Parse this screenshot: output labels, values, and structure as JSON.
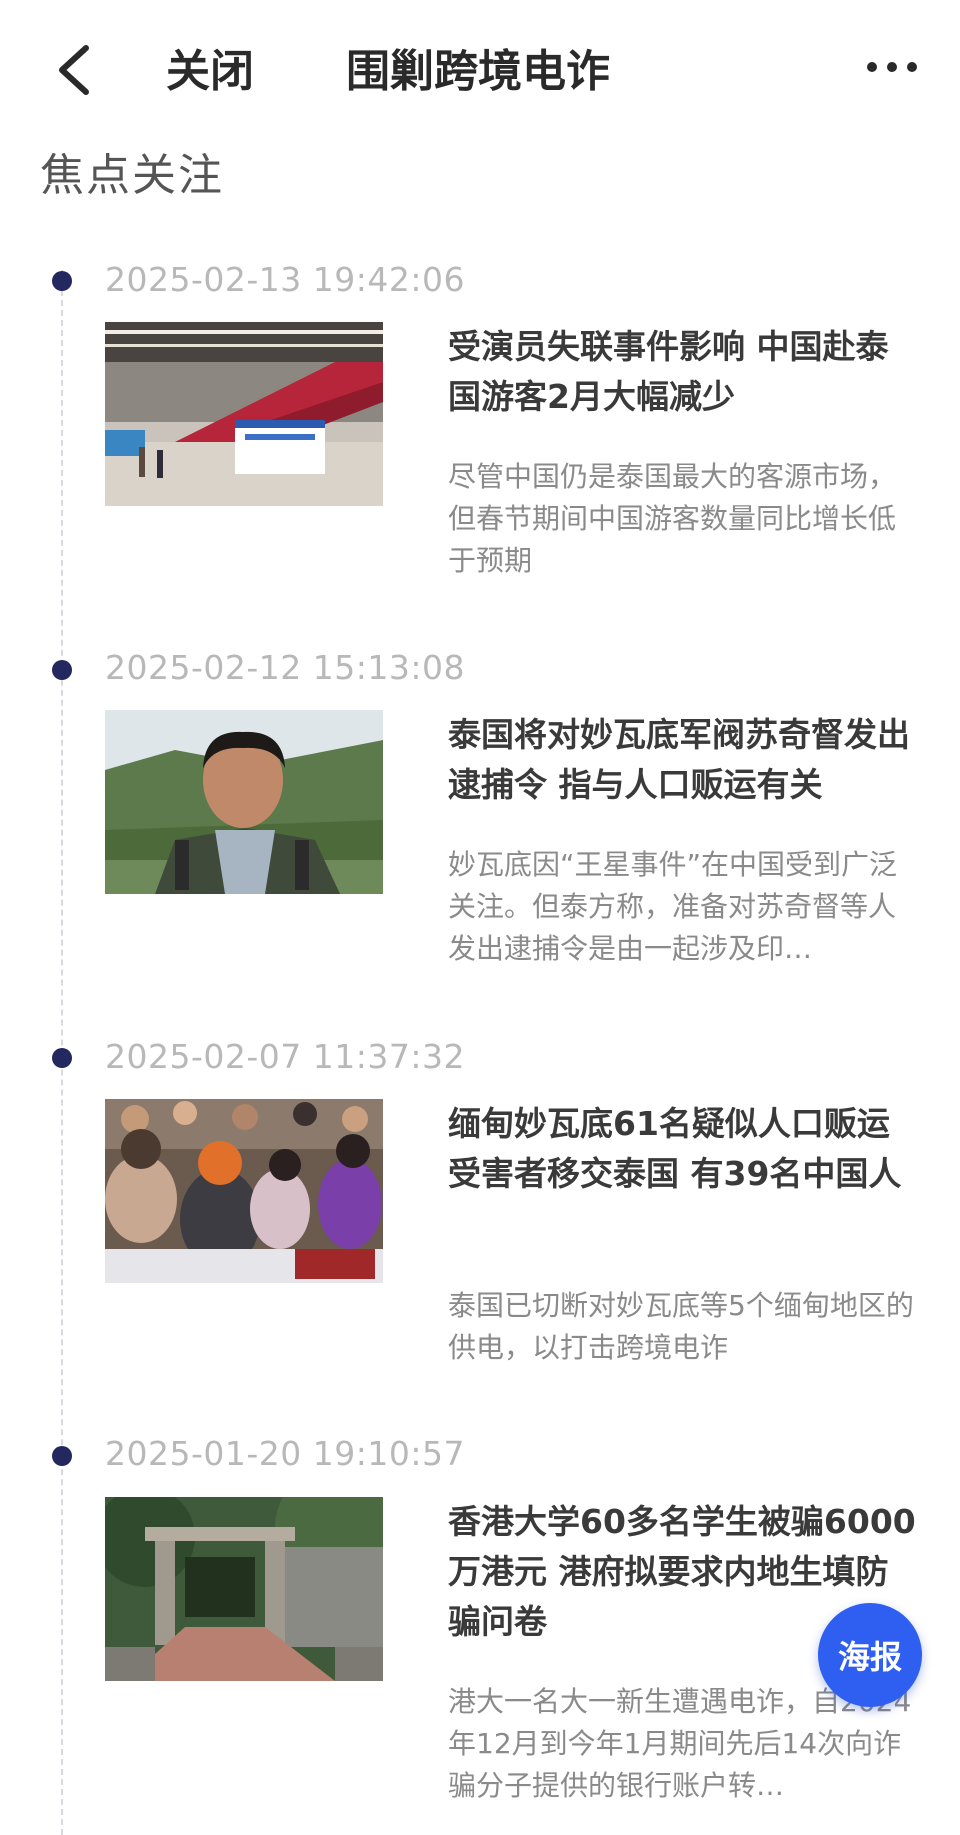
{
  "nav": {
    "back_icon": "chevron-left-icon",
    "close_label": "关闭",
    "title": "围剿跨境电诈",
    "more_icon": "more-dots-icon"
  },
  "section": {
    "title": "焦点关注"
  },
  "colors": {
    "timeline_dot": "#23285e",
    "poster_button": "#2f5ff0",
    "timestamp": "#b8b8b8",
    "headline": "#3a3a3a",
    "summary": "#8a8a8a"
  },
  "articles": [
    {
      "timestamp": "2025-02-13 19:42:06",
      "headline": "受演员失联事件影响 中国赴泰国游客2月大幅减少",
      "summary": "尽管中国仍是泰国最大的客源市场，但春节期间中国游客数量同比增长低于预期",
      "image": "airport-terminal-photo"
    },
    {
      "timestamp": "2025-02-12 15:13:08",
      "headline": "泰国将对妙瓦底军阀苏奇督发出逮捕令 指与人口贩运有关",
      "summary": "妙瓦底因“王星事件”在中国受到广泛关注。但泰方称，准备对苏奇督等人发出逮捕令是由一起涉及印…",
      "image": "man-portrait-photo"
    },
    {
      "timestamp": "2025-02-07 11:37:32",
      "headline": "缅甸妙瓦底61名疑似人口贩运受害者移交泰国 有39名中国人",
      "summary": "泰国已切断对妙瓦底等5个缅甸地区的供电，以打击跨境电诈",
      "image": "crowd-seated-photo"
    },
    {
      "timestamp": "2025-01-20 19:10:57",
      "headline": "香港大学60多名学生被骗6000万港元 港府拟要求内地生填防骗问卷",
      "summary": "港大一名大一新生遭遇电诈，自2024年12月到今年1月期间先后14次向诈骗分子提供的银行账户转…",
      "image": "university-gate-photo"
    }
  ],
  "poster_button": {
    "label": "海报"
  }
}
